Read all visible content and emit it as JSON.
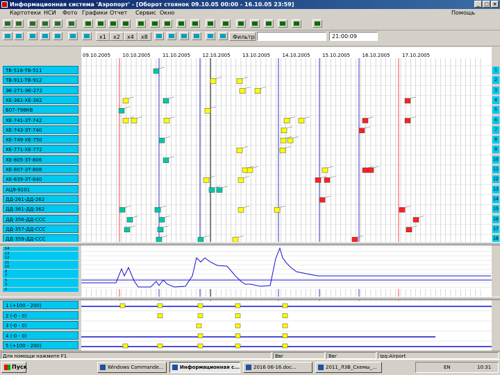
{
  "window": {
    "title": "Информационная система 'Аэропорт' - [Оборот стоянок 09.10.05 00:00 - 16.10.05 23:59]",
    "buttons": [
      "_",
      "□",
      "×"
    ]
  },
  "menu": [
    "Картотеки",
    "НСИ",
    "Фото",
    "Графики",
    "Отчет",
    "Сервис",
    "Окно"
  ],
  "menu_right": "Помощь",
  "toolbar": {
    "filter_label": "Фильтр",
    "time_value": "21:00:09",
    "zoom_labels": [
      "x1",
      "x2",
      "x4",
      "x8"
    ]
  },
  "dates": [
    "09.10.2005",
    "10.10.2005",
    "11.10.2005",
    "12.10.2005",
    "13.10.2005",
    "14.10.2005",
    "15.10.2005",
    "16.10.2005",
    "17.10.2005"
  ],
  "stands": [
    "ТВ-518-ТВ-511",
    "ТВ-911-ТВ-912",
    "ЭЕ-271-ЭЕ-272",
    "ХЕ-361-ХЕ-362",
    "Б07-798КВ",
    "ХЕ-741-ЗТ-742",
    "ХЕ-743-ЗТ-740",
    "ХЕ-749-ХЕ-750",
    "ХЕ-771-ХЕ-772",
    "ХЕ-805-ЗТ-806",
    "ХЕ-807-ЗТ-808",
    "ХЕ-839-ЗТ-840",
    "АЦ9-9101",
    "ДД-261-ДД-262",
    "ДД-361-ДД-362",
    "ДД-356-ДД-ССС",
    "ДД-357-ДД-ССС",
    "ДД-359-ДД-ССС"
  ],
  "load_labels": [
    "14",
    "13",
    "12",
    "11",
    "10",
    "9",
    "7",
    "5",
    "3",
    "0"
  ],
  "gates": [
    "1 (+100 - 200)",
    "2 (-0 - 0)",
    "3 (-0 - 0)",
    "4 (-0 - 0)",
    "5 (+100 - 200)"
  ],
  "status": {
    "hint": "Для помощи нажмите F1",
    "cell2": "Ввг",
    "cell3": "Ввг",
    "cell4": "Ipg:Airport"
  },
  "taskbar": {
    "start": "Пуск",
    "tasks": [
      "Windows Commande...",
      "Информационная с...",
      "2016 06-16.doc...",
      "2011_ЛЗВ_Схемы_..."
    ],
    "tray_lang": "EN",
    "clock": "10:31"
  },
  "colors": {
    "stand_label_bg": "#00c8f0",
    "arrival": "#ffff00",
    "departure": "#ff0000",
    "teal": "#00c8a8",
    "timeline_red": "#ff4040",
    "timeline_blue": "#3030c0"
  }
}
